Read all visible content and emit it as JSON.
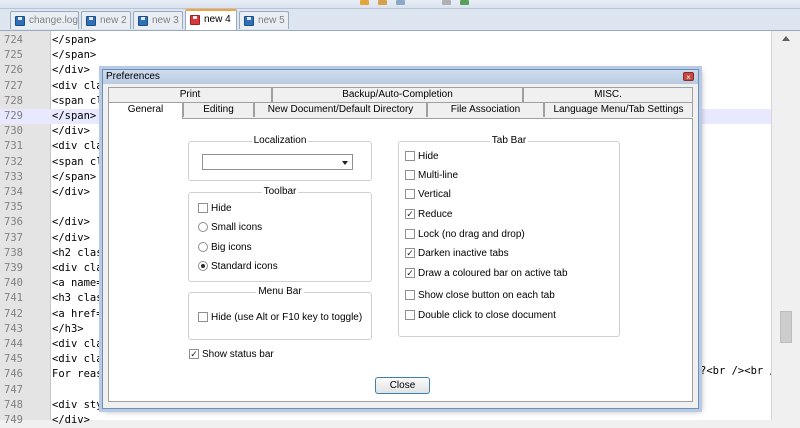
{
  "doc_tabs": [
    {
      "label": "change.log",
      "active": false
    },
    {
      "label": "new  2",
      "active": false
    },
    {
      "label": "new  3",
      "active": false
    },
    {
      "label": "new  4",
      "active": true
    },
    {
      "label": "new  5",
      "active": false
    }
  ],
  "editor": {
    "current_line": 729,
    "lines": [
      {
        "num": "724",
        "code": "</span>"
      },
      {
        "num": "725",
        "code": "</span>"
      },
      {
        "num": "726",
        "code": "</div>"
      },
      {
        "num": "727",
        "code": "<div cla"
      },
      {
        "num": "728",
        "code": "<span cl"
      },
      {
        "num": "729",
        "code": "</span>"
      },
      {
        "num": "730",
        "code": "</div>"
      },
      {
        "num": "731",
        "code": "<div cla"
      },
      {
        "num": "732",
        "code": "<span cl"
      },
      {
        "num": "733",
        "code": "</span>"
      },
      {
        "num": "734",
        "code": "</div>"
      },
      {
        "num": "735",
        "code": ""
      },
      {
        "num": "736",
        "code": "</div>"
      },
      {
        "num": "737",
        "code": "</div>"
      },
      {
        "num": "738",
        "code": "<h2 clas"
      },
      {
        "num": "739",
        "code": "<div cla"
      },
      {
        "num": "740",
        "code": "<a name="
      },
      {
        "num": "741",
        "code": "<h3 clas"
      },
      {
        "num": "742",
        "code": "<a href="
      },
      {
        "num": "743",
        "code": "</h3>"
      },
      {
        "num": "744",
        "code": "<div cla"
      },
      {
        "num": "745",
        "code": "<div cla"
      },
      {
        "num": "746",
        "code": "For reas"
      },
      {
        "num": "747",
        "code": ""
      },
      {
        "num": "748",
        "code": "<div sty"
      },
      {
        "num": "749",
        "code": "</div>"
      }
    ],
    "overflow_text": "?<br /><br /"
  },
  "dialog": {
    "title": "Preferences",
    "close_glyph": "×",
    "tabs_row1": [
      "Print",
      "Backup/Auto-Completion",
      "MISC."
    ],
    "tabs_row2": [
      "General",
      "Editing",
      "New Document/Default Directory",
      "File Association",
      "Language Menu/Tab Settings"
    ],
    "active_tab": "General",
    "localization": {
      "label": "Localization",
      "selected": ""
    },
    "toolbar": {
      "label": "Toolbar",
      "hide": {
        "label": "Hide",
        "checked": false
      },
      "options": [
        {
          "label": "Small icons",
          "selected": false
        },
        {
          "label": "Big icons",
          "selected": false
        },
        {
          "label": "Standard icons",
          "selected": true
        }
      ]
    },
    "menu_bar": {
      "label": "Menu Bar",
      "hide": {
        "label": "Hide (use Alt or F10 key to toggle)",
        "checked": false
      }
    },
    "show_status_bar": {
      "label": "Show status bar",
      "checked": true
    },
    "tab_bar": {
      "label": "Tab Bar",
      "options": [
        {
          "label": "Hide",
          "checked": false
        },
        {
          "label": "Multi-line",
          "checked": false
        },
        {
          "label": "Vertical",
          "checked": false
        },
        {
          "label": "Reduce",
          "checked": true
        },
        {
          "label": "Lock (no drag and drop)",
          "checked": false
        },
        {
          "label": "Darken inactive tabs",
          "checked": true
        },
        {
          "label": "Draw a coloured bar on active tab",
          "checked": true
        },
        {
          "label": "Show close button on each tab",
          "checked": false
        },
        {
          "label": "Double click to close document",
          "checked": false
        }
      ]
    },
    "close_button": "Close",
    "check_glyph": "✓"
  }
}
